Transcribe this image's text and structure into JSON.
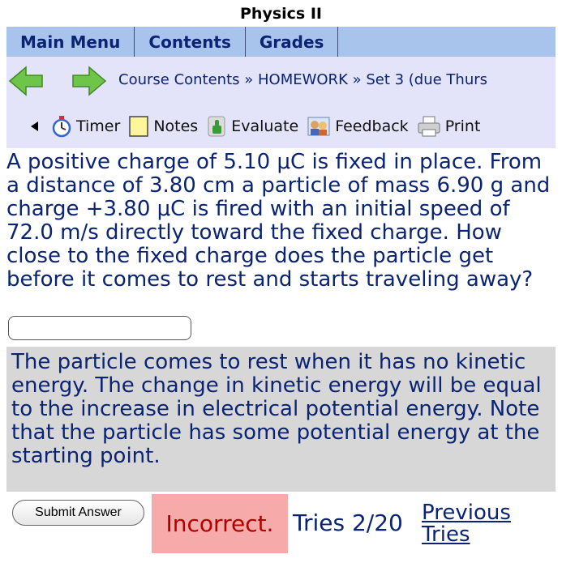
{
  "header": {
    "title": "Physics II"
  },
  "menu": {
    "items": [
      {
        "label": "Main Menu"
      },
      {
        "label": "Contents"
      },
      {
        "label": "Grades"
      }
    ]
  },
  "nav": {
    "breadcrumb": "Course Contents » HOMEWORK » Set 3 (due Thurs"
  },
  "tools": {
    "timer": "Timer",
    "notes": "Notes",
    "evaluate": "Evaluate",
    "feedback": "Feedback",
    "print": "Print"
  },
  "problem": {
    "question": "A positive charge of 5.10 μC is fixed in place. From a distance of 3.80 cm a particle of mass 6.90 g and charge +3.80 μC is fired with an initial speed of 72.0 m/s directly toward the fixed charge. How close to the fixed charge does the particle get before it comes to rest and starts traveling away?",
    "answer_value": "",
    "hint": "The particle comes to rest when it has no kinetic energy. The change in kinetic energy will be equal to the increase in electrical potential energy. Note that the particle has some potential energy at the starting point."
  },
  "footer": {
    "submit_label": "Submit Answer",
    "status": "Incorrect.",
    "tries": "Tries 2/20",
    "previous_tries": "Previous Tries"
  },
  "colors": {
    "menu_bg": "#a9c4ec",
    "nav_bg": "#e3e3f9",
    "text_blue": "#0a2473",
    "hint_bg": "#d7d7d7",
    "incorrect_bg": "#f7aaaa"
  }
}
